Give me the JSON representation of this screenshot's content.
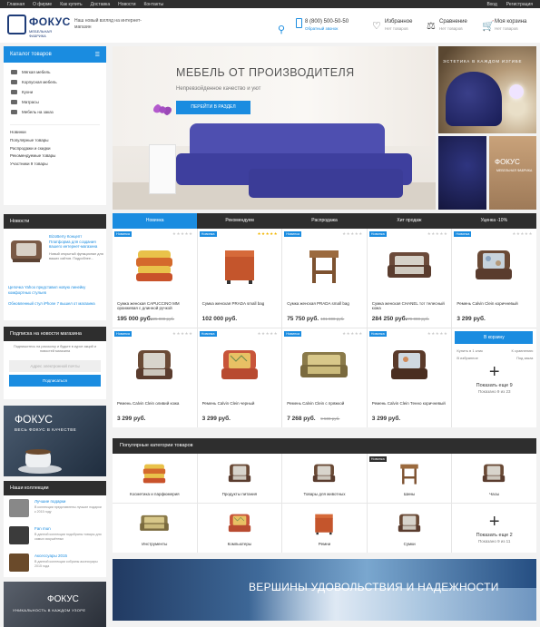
{
  "topbar": {
    "links": [
      "Главная",
      "О фирме",
      "Как купить",
      "Доставка",
      "Новости",
      "Контакты"
    ],
    "login": "Вход",
    "register": "Регистрация"
  },
  "header": {
    "logo": "ФОКУС",
    "logo_sub": "МЕБЕЛЬНАЯ ФАБРИКА",
    "slogan": "Наш новый взгляд на интернет-магазин",
    "phone": "8 (800) 500-50-50",
    "callback": "Обратный звонок",
    "favorites": "Избранное",
    "favorites_sub": "Нет товаров",
    "compare": "Сравнение",
    "compare_sub": "Нет товаров",
    "cart": "Моя корзина",
    "cart_sub": "Нет товаров",
    "search_icon": "search-icon"
  },
  "sidebar": {
    "catalog_title": "Каталог товаров",
    "categories": [
      "Мягкая мебель",
      "Корпусная мебель",
      "Кухни",
      "Матрасы",
      "Мебель на заказ"
    ],
    "links": [
      "Новинки",
      "Популярные товары",
      "Распродажи и скидки",
      "Рекомендуемые товары",
      "Участники 9 товары"
    ],
    "news_title": "Новости",
    "news": [
      {
        "title": "BizoBerry Концепт Платформа для создания вашего интернет-магазина",
        "text": "Новый открытый функционал для ваших сайтов. Подробнее..."
      },
      {
        "title": "Цепочка Yahoo представил новую линейку комфортных стульев",
        "text": ""
      },
      {
        "title": "Обновленный стул iPhone 7 вышел от магазина",
        "text": ""
      }
    ],
    "subscribe_title": "Подписка на новости магазина",
    "subscribe_text": "Подпишитесь на рассылку и будьте в курсе акций и новостей магазина",
    "subscribe_placeholder": "Адрес электронной почты",
    "subscribe_button": "Подписаться",
    "promo_title": "ФОКУС",
    "promo_sub": "ВЕСЬ ФОКУС В КАЧЕСТВЕ",
    "collections_title": "Наши коллекции",
    "collections": [
      {
        "name": "Лучшие подарки",
        "text": "В коллекции представлены лучшие подарки к 2015 году"
      },
      {
        "name": "Fan mun",
        "text": "В данной коллекции подобраны товары для самых искушённых"
      },
      {
        "name": "Аксессуары 2015",
        "text": "В данной коллекции собраны аксессуары 2015 года"
      }
    ],
    "promo2_title": "ФОКУС",
    "promo2_sub": "УНИКАЛЬНОСТЬ В КАЖДОМ УЗОРЕ"
  },
  "hero": {
    "title": "МЕБЕЛЬ ОТ ПРОИЗВОДИТЕЛЯ",
    "subtitle": "Непревзойденное качество и уют",
    "button": "ПЕРЕЙТИ В РАЗДЕЛ",
    "side1": "ЭСТЕТИКА В КАЖДОМ ИЗГИБЕ",
    "side3_title": "ФОКУС",
    "side3_sub": "МЕБЕЛЬНАЯ ФАБРИКА"
  },
  "tabs": [
    "Новинка",
    "Рекомендуем",
    "Распродажа",
    "Хит продаж",
    "Уценка -10%"
  ],
  "products": [
    {
      "badge": "Новинка",
      "name": "Сумка женская CAPUCCINO MM оранжевая с длинной ручкой",
      "price": "195 000 руб.",
      "old": "225 000 руб.",
      "kind": "bag-orange",
      "gold": false
    },
    {
      "badge": "Новинка",
      "name": "Сумка женская PRADA small bag",
      "price": "102 000 руб.",
      "old": "",
      "kind": "ottoman",
      "gold": true
    },
    {
      "badge": "Новинка",
      "name": "Сумка женская PRADA small bag",
      "price": "75 750 руб.",
      "old": "101 000 руб.",
      "kind": "stool",
      "gold": false
    },
    {
      "badge": "Новинка",
      "name": "Сумка женская CHANEL тот телесный кожа",
      "price": "284 250 руб.",
      "old": "379 000 руб.",
      "kind": "sofa-grey",
      "gold": false
    },
    {
      "badge": "Новинка",
      "name": "Ремень Calvin Clein коричневый",
      "price": "3 299 руб.",
      "old": "",
      "kind": "chair-floral",
      "gold": false
    },
    {
      "badge": "Новинка",
      "name": "Ремень Calvin Clein оливий кожа",
      "price": "3 299 руб.",
      "old": "",
      "kind": "chair-grey",
      "gold": false
    },
    {
      "badge": "Новинка",
      "name": "Ремень Calvin Clein черный",
      "price": "3 299 руб.",
      "old": "",
      "kind": "chair-pattern",
      "gold": false
    },
    {
      "badge": "Новинка",
      "name": "Ремень Calvin Clein с пряжкой",
      "price": "7 268 руб.",
      "old": "9 500 руб.",
      "kind": "sofa-olive",
      "gold": false
    },
    {
      "badge": "Новинка",
      "name": "Ремень Calvin Clein Тенно коричневый",
      "price": "3 299 руб.",
      "old": "",
      "kind": "chair-brown",
      "gold": false
    }
  ],
  "product_actions": {
    "buy": "В корзину",
    "one_click": "Купить в 1 клик",
    "compare": "К сравнению",
    "favorite": "В избранное",
    "notify": "Под заказ"
  },
  "more_products": {
    "label": "Показать еще 9",
    "count": "Показано 9 из 23"
  },
  "categories": {
    "title": "Популярные категории товаров",
    "items": [
      {
        "name": "Косметика и парфюмерия",
        "kind": "bag-orange",
        "badge": ""
      },
      {
        "name": "Продукты питания",
        "kind": "chair-grey",
        "badge": ""
      },
      {
        "name": "Товары для животных",
        "kind": "chair-grey",
        "badge": ""
      },
      {
        "name": "Шины",
        "kind": "stool",
        "badge": "Новинка"
      },
      {
        "name": "Часы",
        "kind": "chair-grey",
        "badge": ""
      },
      {
        "name": "Инструменты",
        "kind": "sofa-olive",
        "badge": ""
      },
      {
        "name": "Компьютеры",
        "kind": "chair-pattern",
        "badge": ""
      },
      {
        "name": "Ремни",
        "kind": "ottoman",
        "badge": ""
      },
      {
        "name": "Сумки",
        "kind": "chair-grey",
        "badge": ""
      }
    ],
    "more": "Показать еще 2",
    "more_count": "Показано 9 из 11"
  },
  "banner": {
    "title": "ВЕРШИНЫ УДОВОЛЬСТВИЯ И НАДЕЖНОСТИ"
  },
  "colors": {
    "accent": "#1a8ce0",
    "dark": "#2e2e2e",
    "brand": "#1e3c78"
  }
}
